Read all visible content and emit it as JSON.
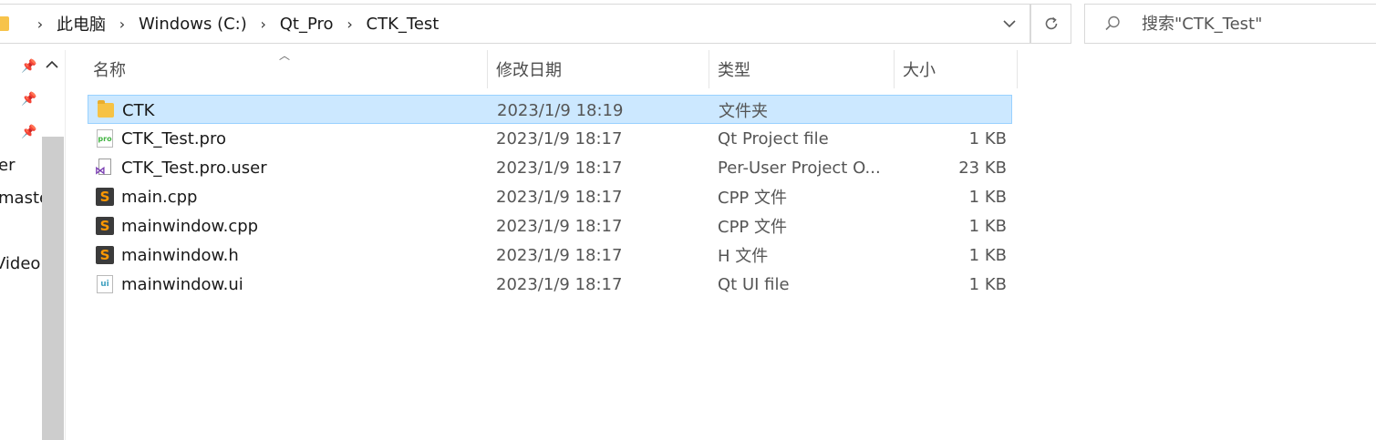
{
  "address_bar": {
    "crumbs": [
      "此电脑",
      "Windows (C:)",
      "Qt_Pro",
      "CTK_Test"
    ],
    "dropdown_icon": "chevron-down-icon",
    "refresh_icon": "refresh-icon"
  },
  "search": {
    "placeholder": "搜索\"CTK_Test\""
  },
  "nav_pane": {
    "items": [
      "er",
      "maste",
      "Video"
    ]
  },
  "columns": {
    "name": "名称",
    "date": "修改日期",
    "type": "类型",
    "size": "大小"
  },
  "files": [
    {
      "name": "CTK",
      "date": "2023/1/9 18:19",
      "type": "文件夹",
      "size": "",
      "icon": "folder-icon",
      "selected": true
    },
    {
      "name": "CTK_Test.pro",
      "date": "2023/1/9 18:17",
      "type": "Qt Project file",
      "size": "1 KB",
      "icon": "qt-pro-file-icon"
    },
    {
      "name": "CTK_Test.pro.user",
      "date": "2023/1/9 18:17",
      "type": "Per-User Project O...",
      "size": "23 KB",
      "icon": "vs-user-file-icon"
    },
    {
      "name": "main.cpp",
      "date": "2023/1/9 18:17",
      "type": "CPP 文件",
      "size": "1 KB",
      "icon": "sublime-file-icon"
    },
    {
      "name": "mainwindow.cpp",
      "date": "2023/1/9 18:17",
      "type": "CPP 文件",
      "size": "1 KB",
      "icon": "sublime-file-icon"
    },
    {
      "name": "mainwindow.h",
      "date": "2023/1/9 18:17",
      "type": "H 文件",
      "size": "1 KB",
      "icon": "sublime-file-icon"
    },
    {
      "name": "mainwindow.ui",
      "date": "2023/1/9 18:17",
      "type": "Qt UI file",
      "size": "1 KB",
      "icon": "qt-ui-file-icon"
    }
  ],
  "colors": {
    "selection_bg": "#cce8ff",
    "selection_border": "#99d1ff",
    "folder": "#f6c244"
  }
}
